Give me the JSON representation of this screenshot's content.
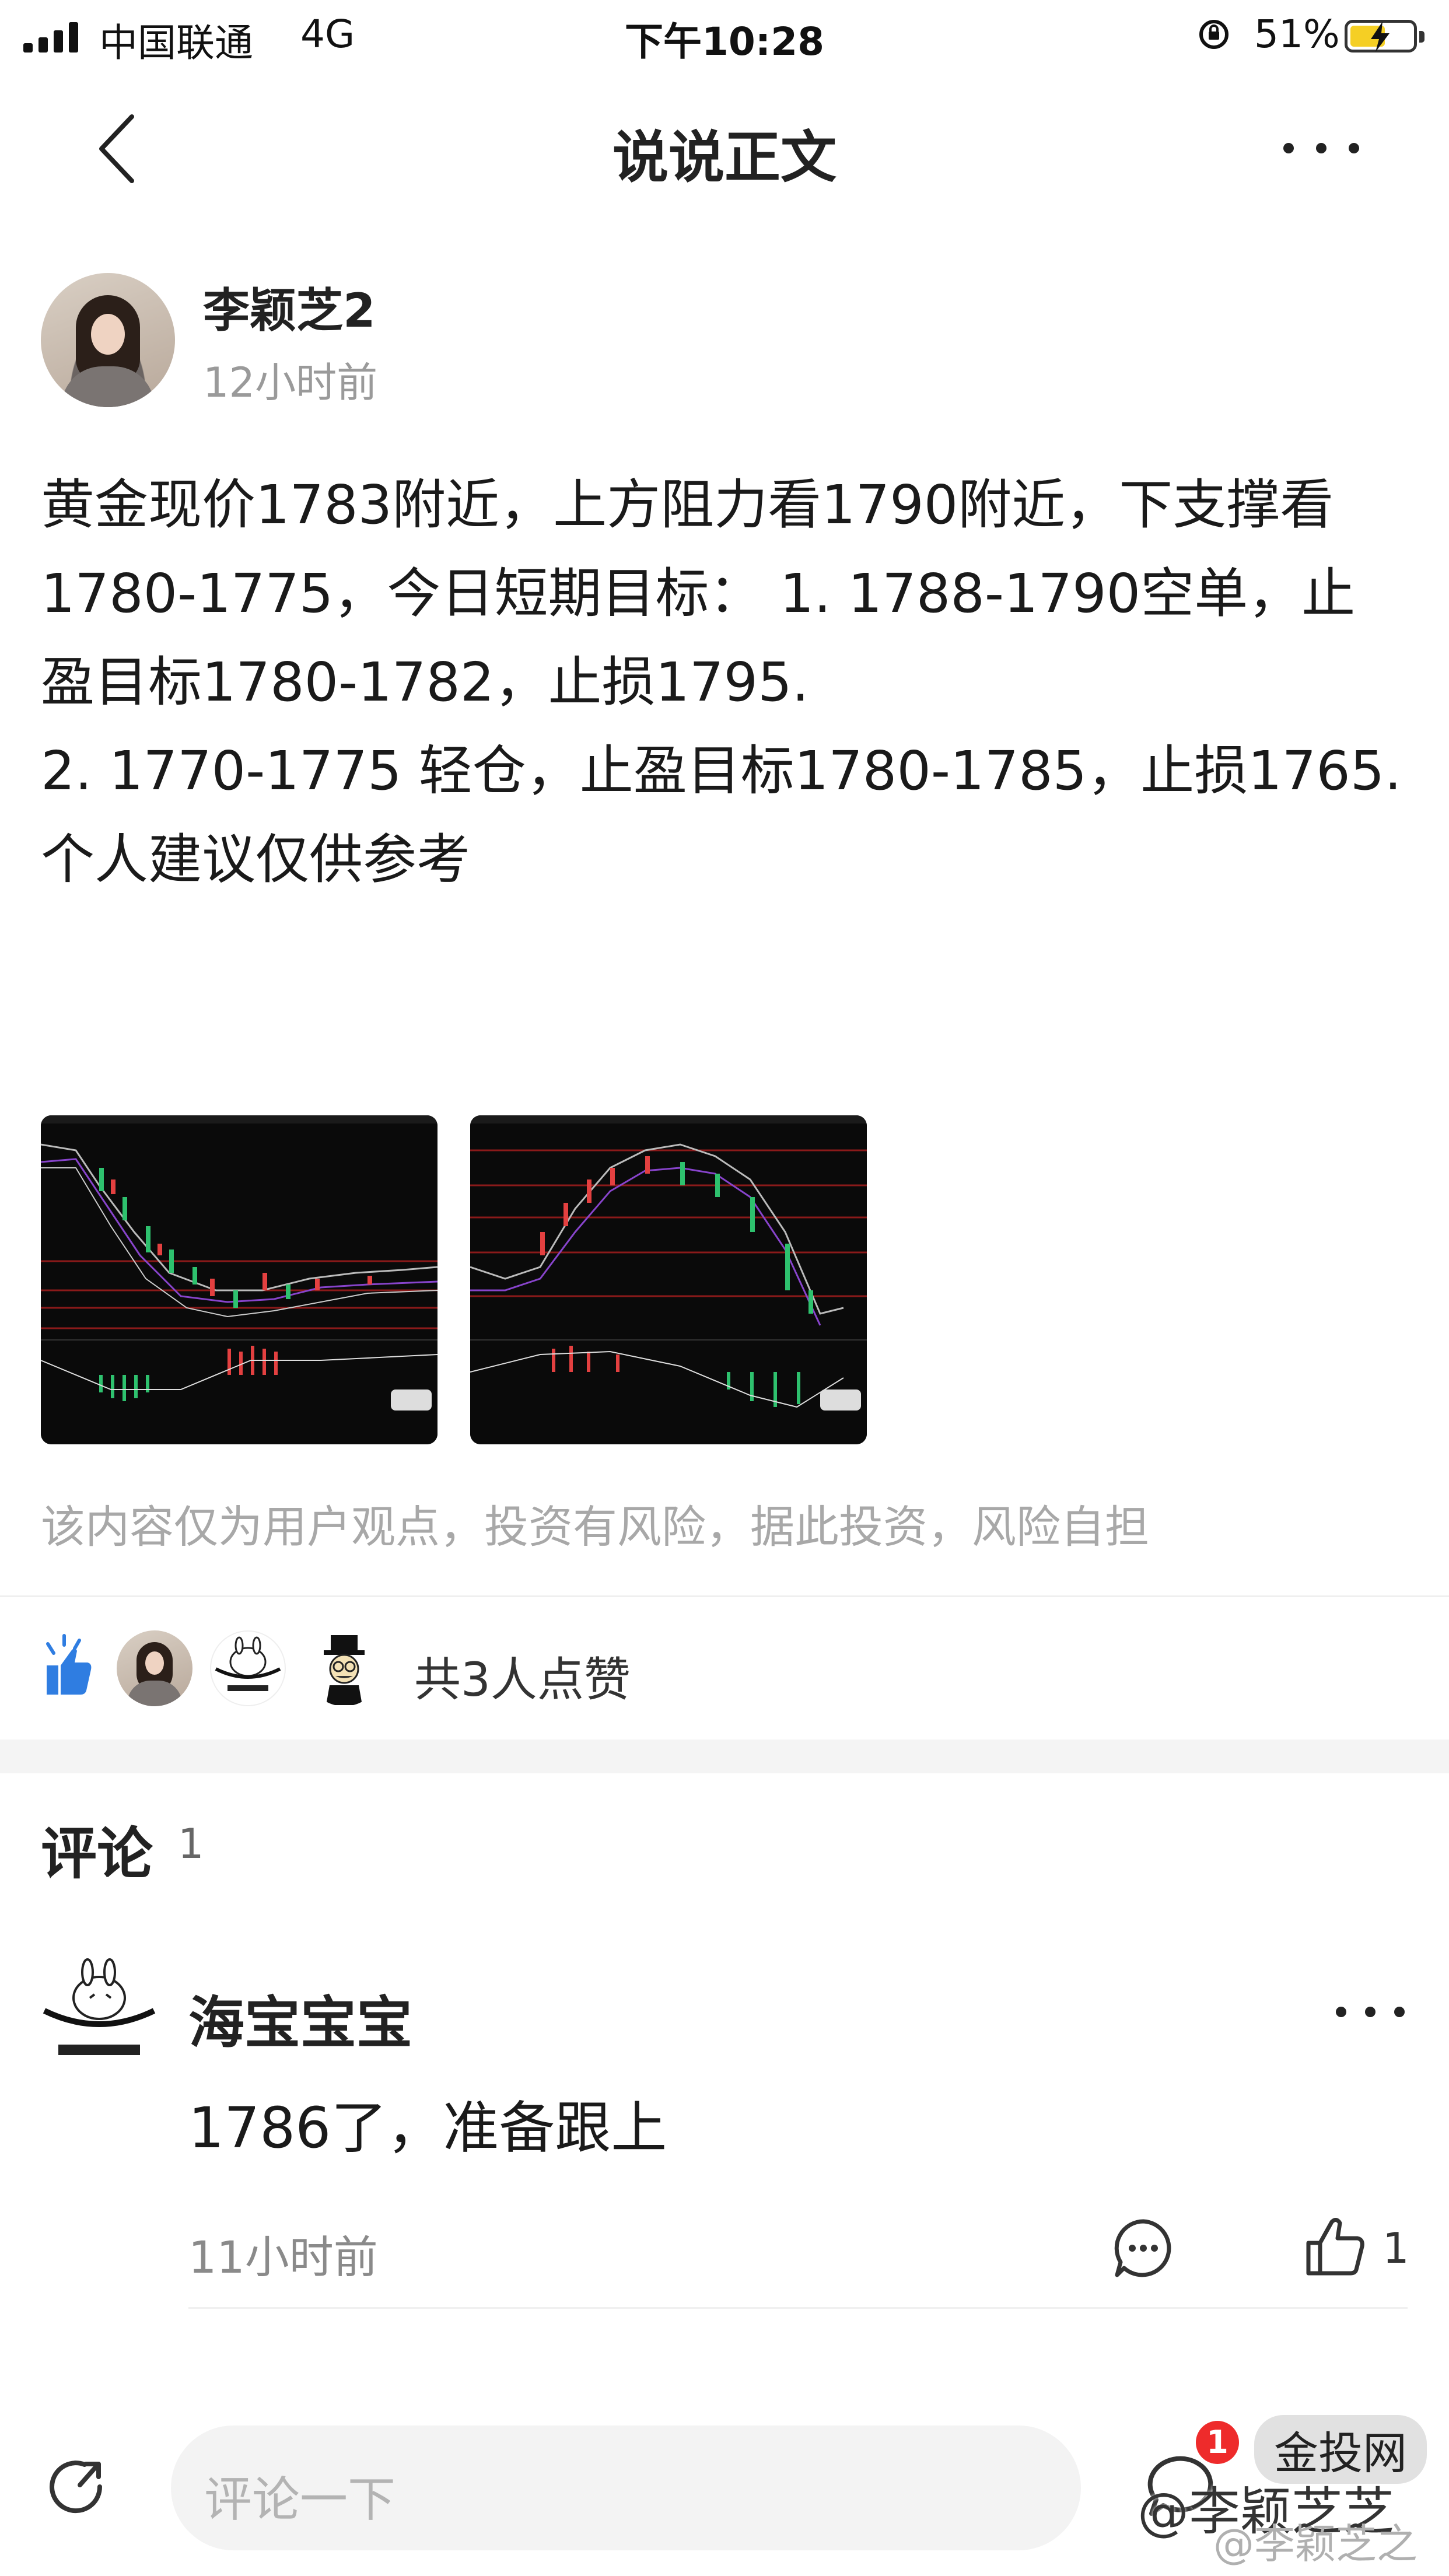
{
  "status_bar": {
    "carrier": "中国联通",
    "network": "4G",
    "time": "下午10:28",
    "battery": "51%"
  },
  "nav": {
    "title": "说说正文",
    "back_icon": "chevron-left-icon",
    "more_icon": "more-horizontal-icon"
  },
  "post": {
    "author": "李颖芝2",
    "time": "12小时前",
    "content": "黄金现价1783附近，上方阻力看1790附近，下支撑看1780-1775，今日短期目标： 1. 1788-1790空单，止盈目标1780-1782，止损1795.\n2. 1770-1775 轻仓，止盈目标1780-1785，止损1765.\n个人建议仅供参考",
    "disclaimer": "该内容仅为用户观点，投资有风险，据此投资，风险自担"
  },
  "likes": {
    "icon": "thumbs-up-icon",
    "summary": "共3人点赞"
  },
  "comments": {
    "title": "评论",
    "count": "1",
    "items": [
      {
        "name": "海宝宝宝",
        "text": "1786了，准备跟上",
        "time": "11小时前",
        "like_count": "1"
      }
    ]
  },
  "bottom_bar": {
    "input_placeholder": "评论一下",
    "unread_badge": "1"
  },
  "watermarks": {
    "site": "金投网",
    "handle": "@李颖芝芝",
    "handle_faint": "@李颖芝之"
  }
}
